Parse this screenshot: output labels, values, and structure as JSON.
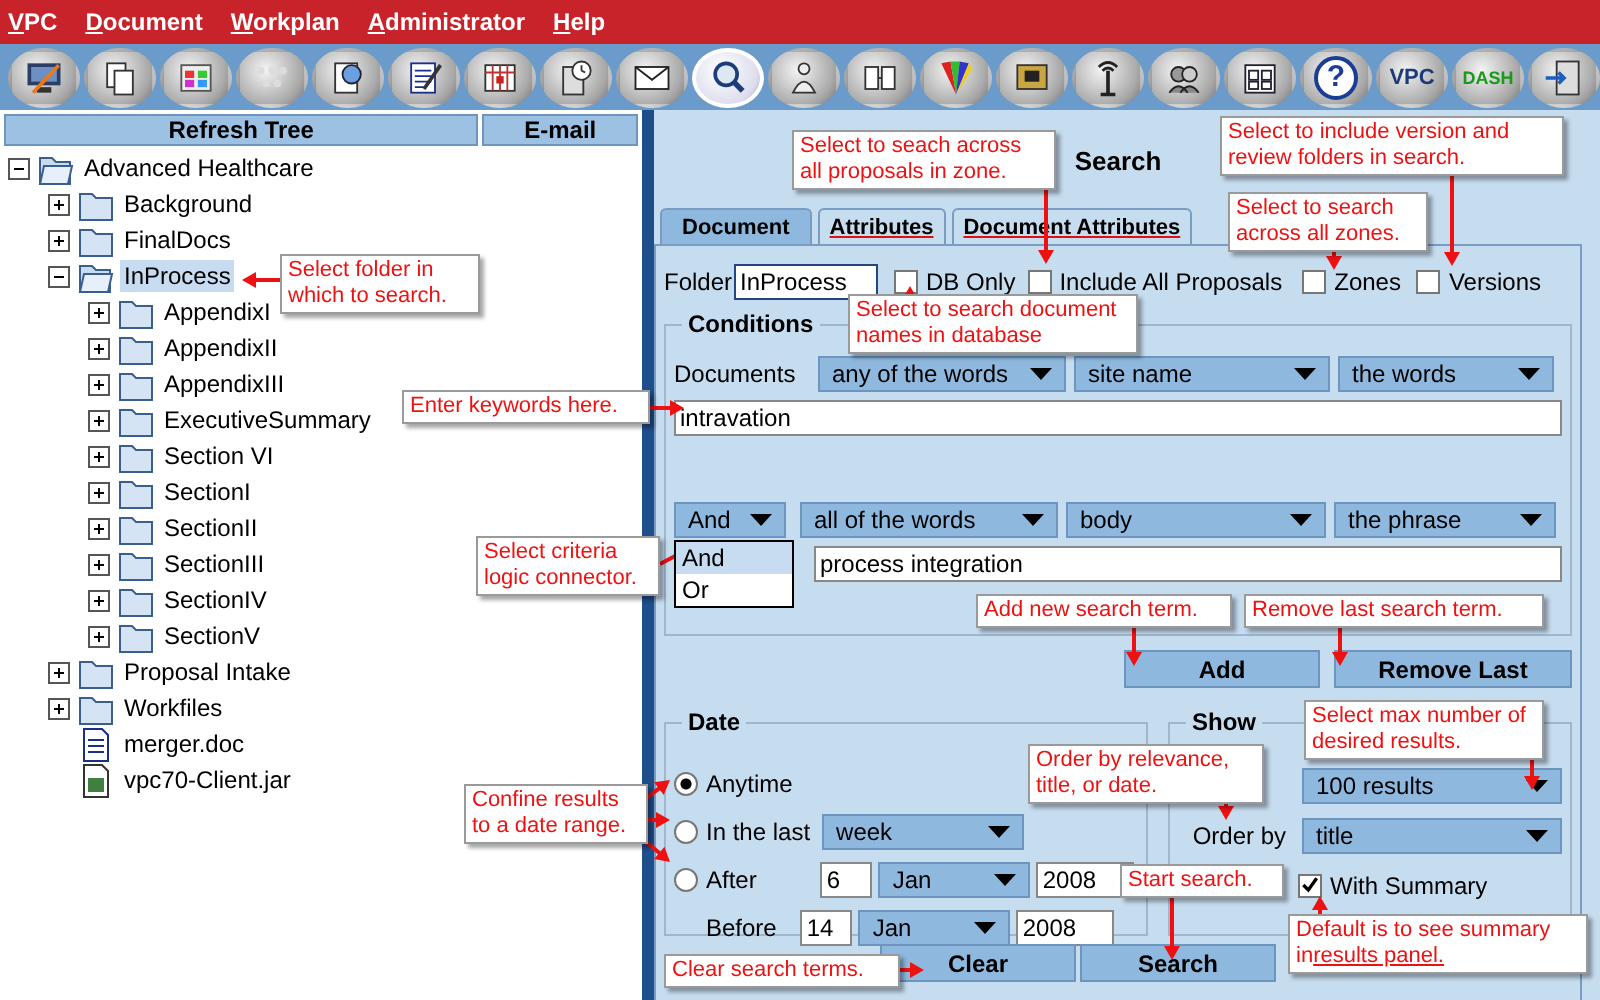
{
  "menu": [
    {
      "label": "VPC"
    },
    {
      "label": "Document"
    },
    {
      "label": "Workplan"
    },
    {
      "label": "Administrator"
    },
    {
      "label": "Help"
    }
  ],
  "toolbar": [
    {
      "selected": false
    },
    {
      "selected": false
    },
    {
      "selected": false
    },
    {
      "selected": false
    },
    {
      "selected": false
    },
    {
      "selected": false
    },
    {
      "selected": false
    },
    {
      "selected": false
    },
    {
      "selected": false
    },
    {
      "selected": true
    },
    {
      "selected": false
    },
    {
      "selected": false
    },
    {
      "selected": false
    },
    {
      "selected": false
    },
    {
      "selected": false
    },
    {
      "selected": false
    },
    {
      "selected": false
    },
    {
      "selected": false,
      "label": "?"
    },
    {
      "selected": false,
      "label": "VPC"
    },
    {
      "selected": false,
      "label": "DASH"
    },
    {
      "selected": false
    }
  ],
  "tree_header": [
    "Refresh Tree",
    "E-mail"
  ],
  "tree": [
    {
      "label": "Advanced Healthcare",
      "kind": "folder",
      "expanded": true,
      "selected": false,
      "children": [
        {
          "label": "Background",
          "kind": "folder",
          "expanded": false,
          "selected": false
        },
        {
          "label": "FinalDocs",
          "kind": "folder",
          "expanded": false,
          "selected": false
        },
        {
          "label": "InProcess",
          "kind": "folder",
          "expanded": true,
          "selected": true,
          "children": [
            {
              "label": "AppendixI",
              "kind": "folder",
              "expanded": false,
              "selected": false
            },
            {
              "label": "AppendixII",
              "kind": "folder",
              "expanded": false,
              "selected": false
            },
            {
              "label": "AppendixIII",
              "kind": "folder",
              "expanded": false,
              "selected": false
            },
            {
              "label": "ExecutiveSummary",
              "kind": "folder",
              "expanded": false,
              "selected": false
            },
            {
              "label": "Section VI",
              "kind": "folder",
              "expanded": false,
              "selected": false
            },
            {
              "label": "SectionI",
              "kind": "folder",
              "expanded": false,
              "selected": false
            },
            {
              "label": "SectionII",
              "kind": "folder",
              "expanded": false,
              "selected": false
            },
            {
              "label": "SectionIII",
              "kind": "folder",
              "expanded": false,
              "selected": false
            },
            {
              "label": "SectionIV",
              "kind": "folder",
              "expanded": false,
              "selected": false
            },
            {
              "label": "SectionV",
              "kind": "folder",
              "expanded": false,
              "selected": false
            }
          ]
        },
        {
          "label": "Proposal Intake",
          "kind": "folder",
          "expanded": false,
          "selected": false
        },
        {
          "label": "Workfiles",
          "kind": "folder",
          "expanded": false,
          "selected": false
        },
        {
          "label": "merger.doc",
          "kind": "document",
          "selected": false
        },
        {
          "label": "vpc70-Client.jar",
          "kind": "archive",
          "selected": false
        }
      ]
    }
  ],
  "search": {
    "title": "Search",
    "tabs": [
      {
        "label": "Document",
        "selected": true,
        "underlined": false
      },
      {
        "label": "Attributes",
        "selected": false,
        "underlined": true
      },
      {
        "label": "Document Attributes",
        "selected": false,
        "underlined": true
      }
    ],
    "folder": {
      "label": "Folder",
      "value": "InProcess"
    },
    "options": [
      {
        "label": "DB Only",
        "checked": false
      },
      {
        "label": "Include All Proposals",
        "checked": false
      },
      {
        "label": "Zones",
        "checked": false
      },
      {
        "label": "Versions",
        "checked": false
      }
    ],
    "conditions": {
      "title": "Conditions",
      "row_label": "Documents",
      "first": {
        "dropdowns": [
          "any of the words",
          "site name",
          "the words"
        ],
        "value": "intravation"
      },
      "second": {
        "connector": "And",
        "connector_options": [
          {
            "label": "And",
            "selected": true
          },
          {
            "label": "Or",
            "selected": false
          }
        ],
        "dropdowns": [
          "all of the words",
          "body",
          "the phrase"
        ],
        "value": "process integration"
      },
      "buttons": [
        "Add",
        "Remove Last"
      ]
    },
    "date": {
      "title": "Date",
      "options": [
        {
          "label": "Anytime",
          "selected": true
        },
        {
          "label": "In the last",
          "selected": false
        },
        {
          "label": "After",
          "selected": false
        }
      ],
      "period": "week",
      "after": {
        "day": "6",
        "month": "Jan",
        "year": "2008"
      },
      "before": {
        "label": "Before",
        "day": "14",
        "month": "Jan",
        "year": "2008"
      }
    },
    "show": {
      "title": "Show",
      "limit": "100 results",
      "order_label": "Order by",
      "order": "title",
      "summary": {
        "label": "With Summary",
        "checked": true
      }
    },
    "actions": [
      "Clear",
      "Search"
    ]
  },
  "callouts": [
    {
      "text": "Select folder in which to search."
    },
    {
      "text": "Enter keywords here."
    },
    {
      "text": "Select criteria logic connector."
    },
    {
      "text": "Select to seach across all proposals in zone."
    },
    {
      "text": "Select to include version and review folders in search."
    },
    {
      "text": "Select to search across all zones."
    },
    {
      "text": "Select to search document names in database"
    },
    {
      "text": "Add new search term."
    },
    {
      "text": "Remove last search term."
    },
    {
      "text": "Select max number of desired results."
    },
    {
      "text": "Order by relevance, title, or date."
    },
    {
      "text": "Confine results to a date range."
    },
    {
      "text": "Start search."
    },
    {
      "text": "Default is to see summary in",
      "link": "results panel."
    },
    {
      "text": "Clear search terms."
    }
  ]
}
